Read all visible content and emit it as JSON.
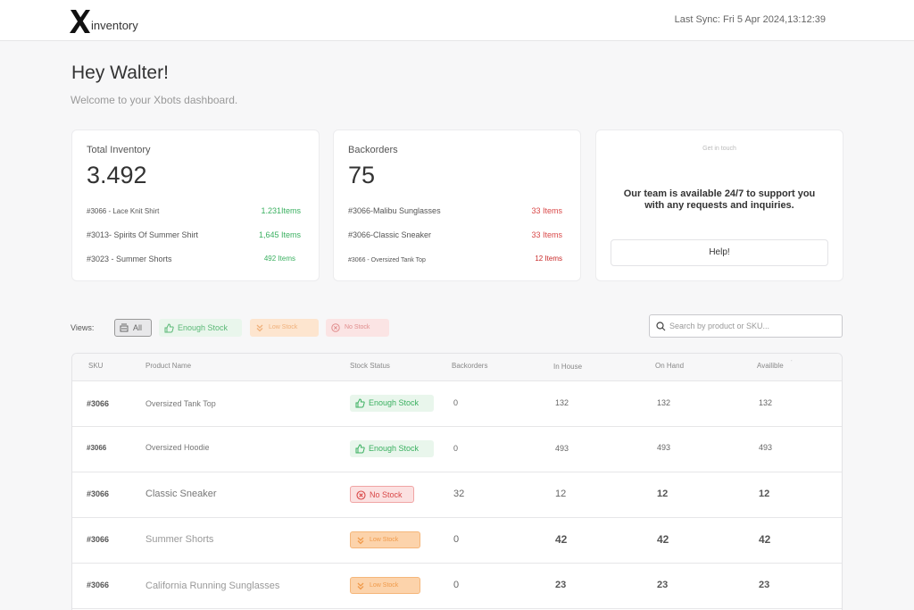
{
  "header": {
    "logo_text": "inventory",
    "last_sync": "Last Sync: Fri 5 Apr 2024,13:12:39"
  },
  "greeting": "Hey Walter!",
  "welcome": "Welcome to your  Xbots dashboard.",
  "total_inventory": {
    "title": "Total Inventory",
    "value": "3.492",
    "items": [
      {
        "name": "#3066 - Lace Knit Shirt",
        "qty": "1.231Items"
      },
      {
        "name": "#3013- Spirits Of Summer Shirt",
        "qty": "1,645 Items"
      },
      {
        "name": "#3023 - Summer Shorts",
        "qty": "492 Items"
      }
    ]
  },
  "backorders": {
    "title": "Backorders",
    "value": "75",
    "items": [
      {
        "name": "#3066-Malibu Sunglasses",
        "qty": "33 Items"
      },
      {
        "name": "#3066-Classic Sneaker",
        "qty": "33 Items"
      },
      {
        "name": "#3066 - Oversized Tank Top",
        "qty": "12 Items"
      }
    ]
  },
  "support": {
    "small_title": "Get in touch",
    "text": "Our team is available 24/7 to support you with any requests and inquiries.",
    "button": "Help!"
  },
  "views": {
    "label": "Views:",
    "all": "All",
    "enough": "Enough Stock",
    "low": "Low Stock",
    "none": "No Stock"
  },
  "search": {
    "placeholder": "Search by product or SKU..."
  },
  "table": {
    "headers": [
      "SKU",
      "Product Name",
      "Stock Status",
      "Backorders",
      "In House",
      "On Hand",
      "Availible"
    ],
    "rows": [
      {
        "sku": "#3066",
        "name": "Oversized Tank Top",
        "status": "Enough Stock",
        "backorders": "0",
        "in_house": "132",
        "on_hand": "132",
        "available": "132"
      },
      {
        "sku": "#3066",
        "name": "Oversized Hoodie",
        "status": "Enough Stock",
        "backorders": "0",
        "in_house": "493",
        "on_hand": "493",
        "available": "493"
      },
      {
        "sku": "#3066",
        "name": "Classic Sneaker",
        "status": "No Stock",
        "backorders": "32",
        "in_house": "12",
        "on_hand": "12",
        "available": "12"
      },
      {
        "sku": "#3066",
        "name": "Summer Shorts",
        "status": "Low Stock",
        "backorders": "0",
        "in_house": "42",
        "on_hand": "42",
        "available": "42"
      },
      {
        "sku": "#3066",
        "name": "California Running Sunglasses",
        "status": "Low Stock",
        "backorders": "0",
        "in_house": "23",
        "on_hand": "23",
        "available": "23"
      }
    ]
  },
  "colors": {
    "enough": "#3ab060",
    "low": "#f09a4a",
    "none": "#d94848"
  }
}
